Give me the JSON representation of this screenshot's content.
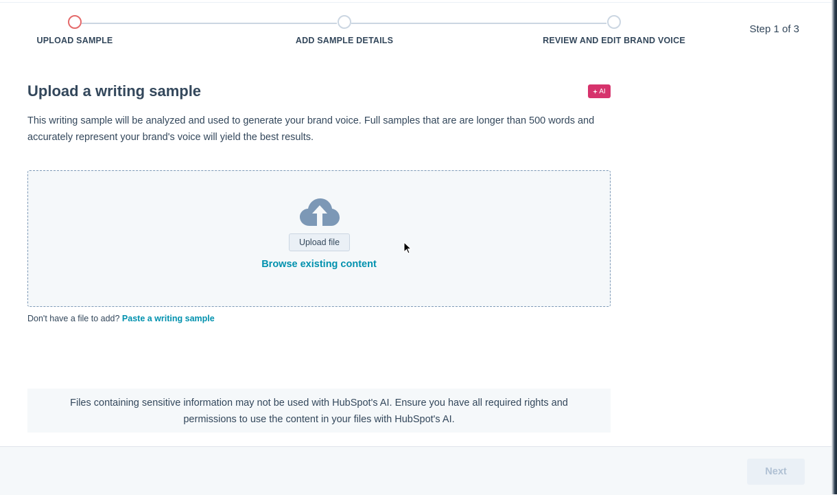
{
  "stepper": {
    "steps": [
      {
        "label": "UPLOAD SAMPLE",
        "state": "active"
      },
      {
        "label": "ADD SAMPLE DETAILS",
        "state": "upcoming"
      },
      {
        "label": "REVIEW AND EDIT BRAND VOICE",
        "state": "upcoming"
      }
    ],
    "step_count": "Step 1 of 3"
  },
  "main": {
    "title": "Upload a writing sample",
    "ai_badge": "AI",
    "ai_badge_icon": "sparkle-icon",
    "description": "This writing sample will be analyzed and used to generate your brand voice. Full samples that are are longer than 500 words and accurately represent your brand's voice will yield the best results.",
    "dropzone": {
      "icon": "cloud-upload-icon",
      "upload_button": "Upload file",
      "browse_link": "Browse existing content"
    },
    "paste_prompt": "Don't have a file to add?",
    "paste_link": "Paste a writing sample",
    "notice": "Files containing sensitive information may not be used with HubSpot's AI. Ensure you have all required rights and permissions to use the content in your files with HubSpot's AI."
  },
  "footer": {
    "next_button": "Next",
    "next_disabled": true
  },
  "colors": {
    "active_step": "#e4696a",
    "link": "#0091ae",
    "ai_badge": "#d6336c",
    "text": "#33475b"
  }
}
